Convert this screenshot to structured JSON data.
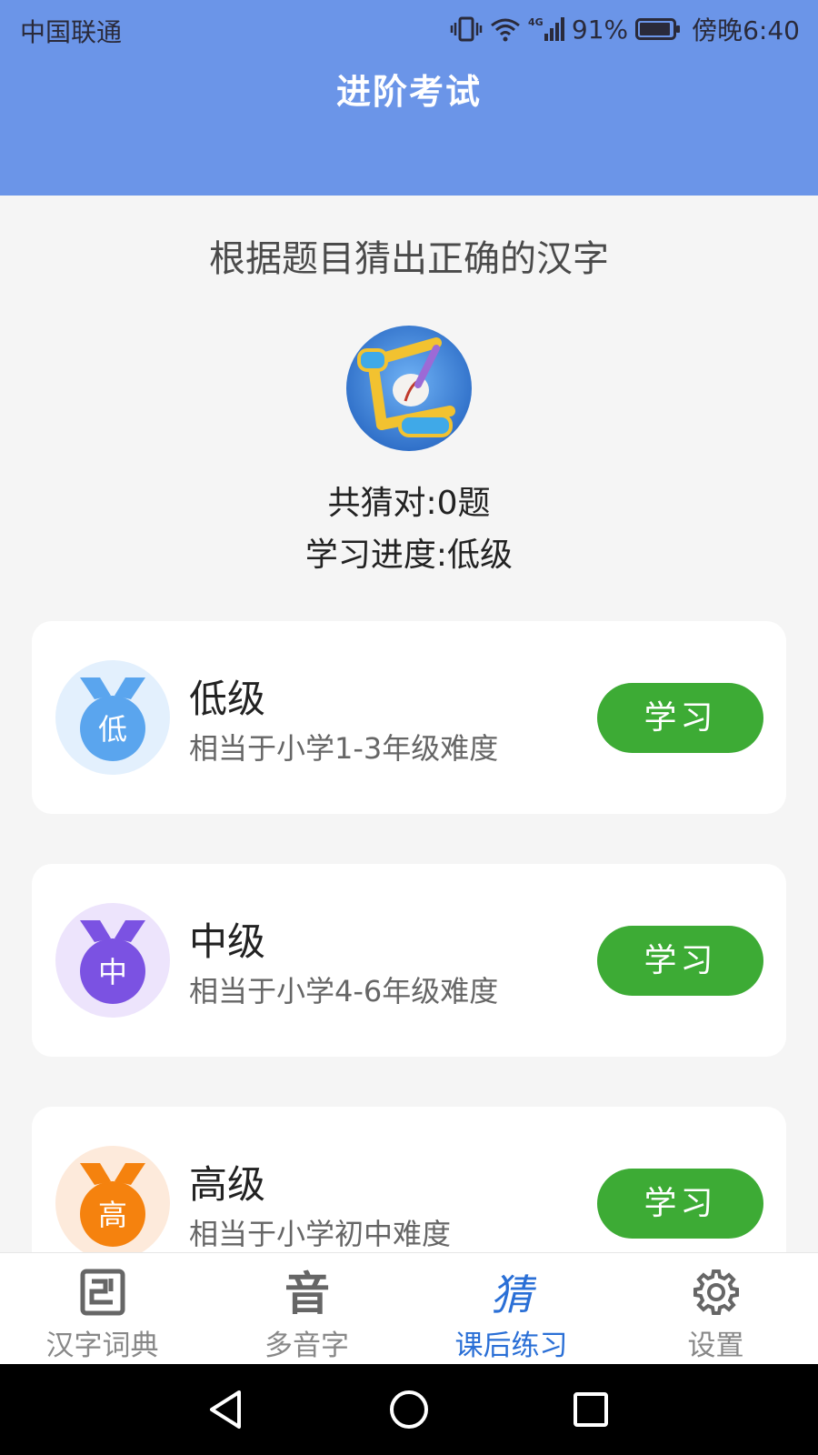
{
  "status_bar": {
    "carrier": "中国联通",
    "network": "4G",
    "battery": "91%",
    "time": "傍晚6:40"
  },
  "header": {
    "title": "进阶考试"
  },
  "instruction": "根据题目猜出正确的汉字",
  "stats": {
    "correct": "共猜对:0题",
    "progress": "学习进度:低级"
  },
  "levels": [
    {
      "title": "低级",
      "desc": "相当于小学1-3年级难度",
      "badge": "低",
      "button": "学习",
      "color": "#5aa5ee",
      "bg": "#e3f0fd"
    },
    {
      "title": "中级",
      "desc": "相当于小学4-6年级难度",
      "badge": "中",
      "button": "学习",
      "color": "#7b52e2",
      "bg": "#ede4fc"
    },
    {
      "title": "高级",
      "desc": "相当于小学初中难度",
      "badge": "高",
      "button": "学习",
      "color": "#f5820e",
      "bg": "#fdeadb"
    }
  ],
  "tabs": [
    {
      "label": "汉字词典",
      "icon": "dictionary-icon"
    },
    {
      "label": "多音字",
      "icon": "polyphone-icon"
    },
    {
      "label": "课后练习",
      "icon": "guess-icon",
      "active": true
    },
    {
      "label": "设置",
      "icon": "gear-icon"
    }
  ],
  "tab_icon_glyphs": {
    "polyphone": "音",
    "guess": "猜"
  },
  "colors": {
    "header": "#6b95e8",
    "button": "#3dab35",
    "active_tab": "#2a6fd6"
  }
}
